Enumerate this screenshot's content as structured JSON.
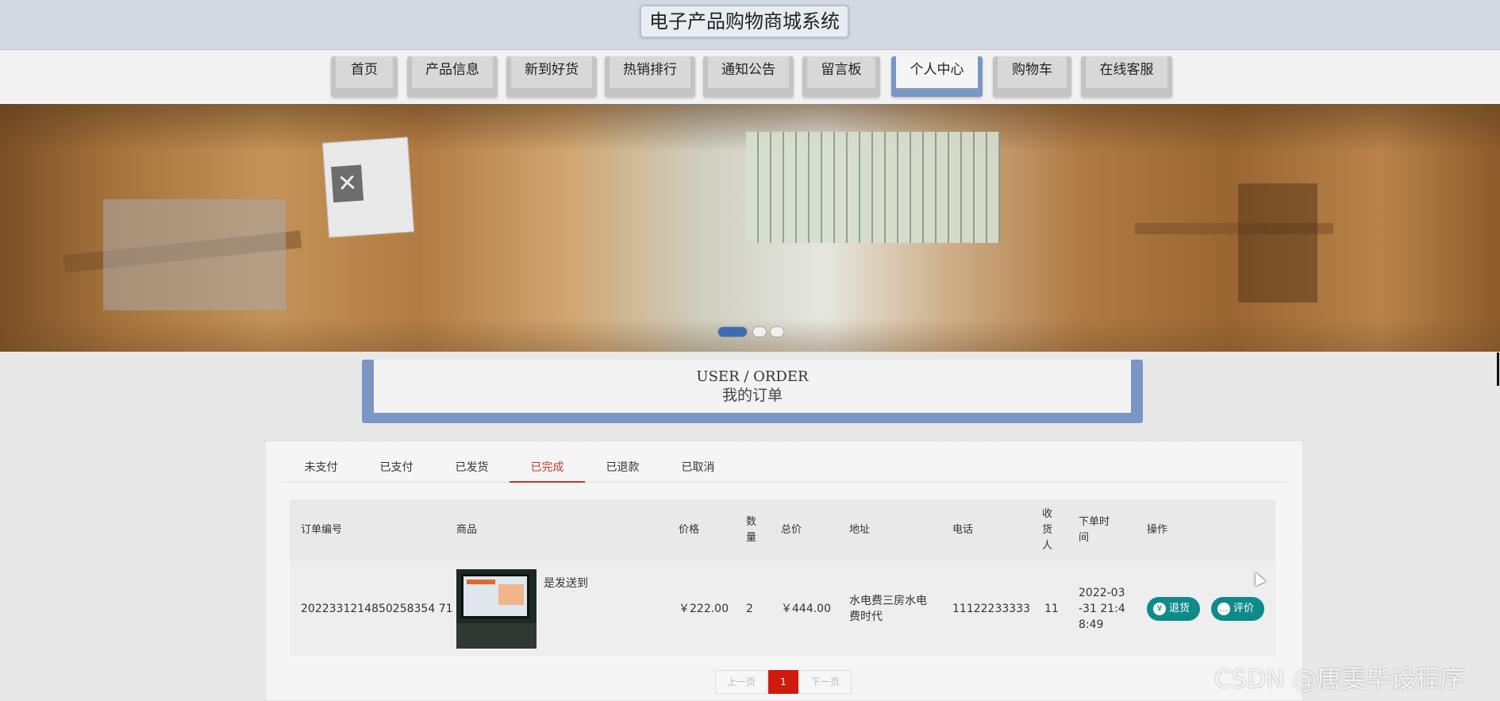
{
  "header": {
    "title": "电子产品购物商城系统"
  },
  "nav": {
    "items": [
      {
        "label": "首页"
      },
      {
        "label": "产品信息"
      },
      {
        "label": "新到好货"
      },
      {
        "label": "热销排行"
      },
      {
        "label": "通知公告"
      },
      {
        "label": "留言板"
      },
      {
        "label": "个人中心",
        "active": true
      },
      {
        "label": "购物车"
      },
      {
        "label": "在线客服"
      }
    ]
  },
  "banner": {
    "slides": 3,
    "active_slide": 1
  },
  "section": {
    "title_en": "USER / ORDER",
    "title_zh": "我的订单"
  },
  "orders": {
    "tabs": [
      {
        "label": "未支付"
      },
      {
        "label": "已支付"
      },
      {
        "label": "已发货"
      },
      {
        "label": "已完成",
        "active": true
      },
      {
        "label": "已退款"
      },
      {
        "label": "已取消"
      }
    ],
    "columns": {
      "order_no": "订单编号",
      "product": "商品",
      "price": "价格",
      "qty": "数量",
      "total": "总价",
      "address": "地址",
      "phone": "电话",
      "receiver": "收货人",
      "time": "下单时间",
      "actions": "操作"
    },
    "rows": [
      {
        "order_no": "2022331214850258354 71",
        "product_name": "是发送到",
        "price": "￥222.00",
        "qty": "2",
        "total": "￥444.00",
        "address": "水电费三房水电费时代",
        "phone": "11122233333",
        "receiver": "11",
        "time": "2022-03-31 21:48:49",
        "refund_label": "退货",
        "review_label": "评价"
      }
    ]
  },
  "pagination": {
    "prev": "上一页",
    "current": "1",
    "next": "下一页"
  },
  "watermark": "CSDN @唐雯毕设程序",
  "colors": {
    "accent": "#7b96c4",
    "active_tab": "#c0392b",
    "button": "#0f8a8a",
    "page_current": "#d0190f"
  }
}
